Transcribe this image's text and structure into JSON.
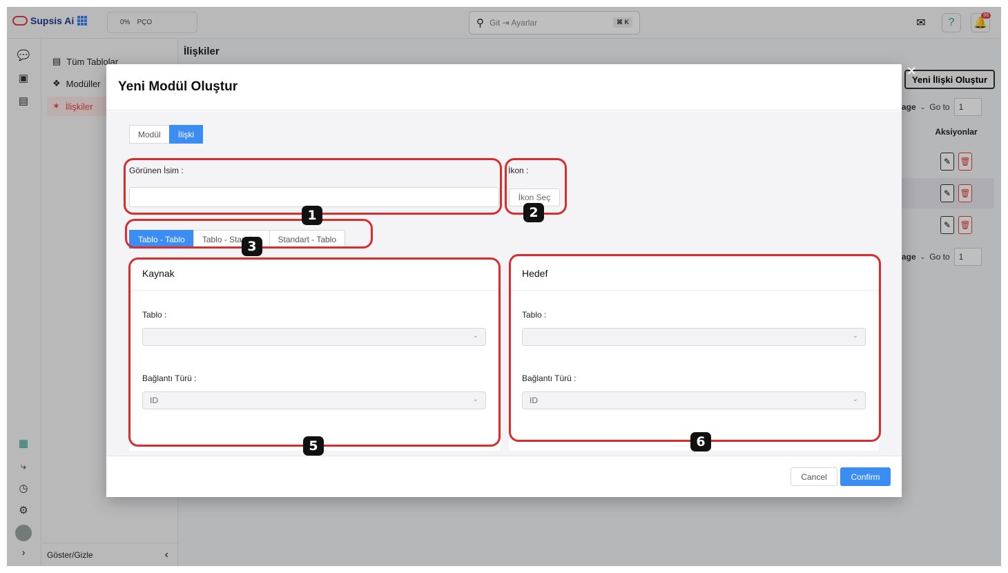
{
  "app": {
    "name": "Supsis Ai",
    "progress_percent": "0%",
    "progress_label": "PÇO",
    "search_placeholder": "Git ⇥ Ayarlar",
    "search_shortcut": "⌘ K",
    "notification_count": "98"
  },
  "subnav": {
    "items": [
      {
        "label": "Tüm Tablolar"
      },
      {
        "label": "Modüller"
      },
      {
        "label": "İlişkiler"
      }
    ],
    "footer_label": "Göster/Gizle"
  },
  "page": {
    "title": "İlişkiler",
    "create_button": "Yeni İlişki Oluştur",
    "pager_label": "age",
    "goto_label": "Go to",
    "goto_value": "1",
    "actions_header": "Aksiyonlar"
  },
  "modal": {
    "title": "Yeni Modül Oluştur",
    "tabs": [
      {
        "label": "Modül",
        "active": false
      },
      {
        "label": "İlişki",
        "active": true
      }
    ],
    "display_name_label": "Görünen İsim",
    "display_name_value": "",
    "icon_label": "İkon",
    "icon_button": "İkon Seç",
    "relation_types": [
      {
        "label": "Tablo - Tablo",
        "active": true
      },
      {
        "label": "Tablo - Standart",
        "active": false
      },
      {
        "label": "Standart - Tablo",
        "active": false
      }
    ],
    "source": {
      "title": "Kaynak",
      "table_label": "Tablo",
      "table_value": "",
      "link_type_label": "Bağlantı Türü",
      "link_type_value": "ID"
    },
    "target": {
      "title": "Hedef",
      "table_label": "Tablo",
      "table_value": "",
      "link_type_label": "Bağlantı Türü",
      "link_type_value": "ID"
    },
    "cancel_label": "Cancel",
    "confirm_label": "Confirm"
  },
  "annotations": [
    "1",
    "2",
    "3",
    "5",
    "6"
  ],
  "colors": {
    "accent": "#3b8df3",
    "highlight_red": "#d92d2d",
    "active_nav": "#e0443e"
  }
}
